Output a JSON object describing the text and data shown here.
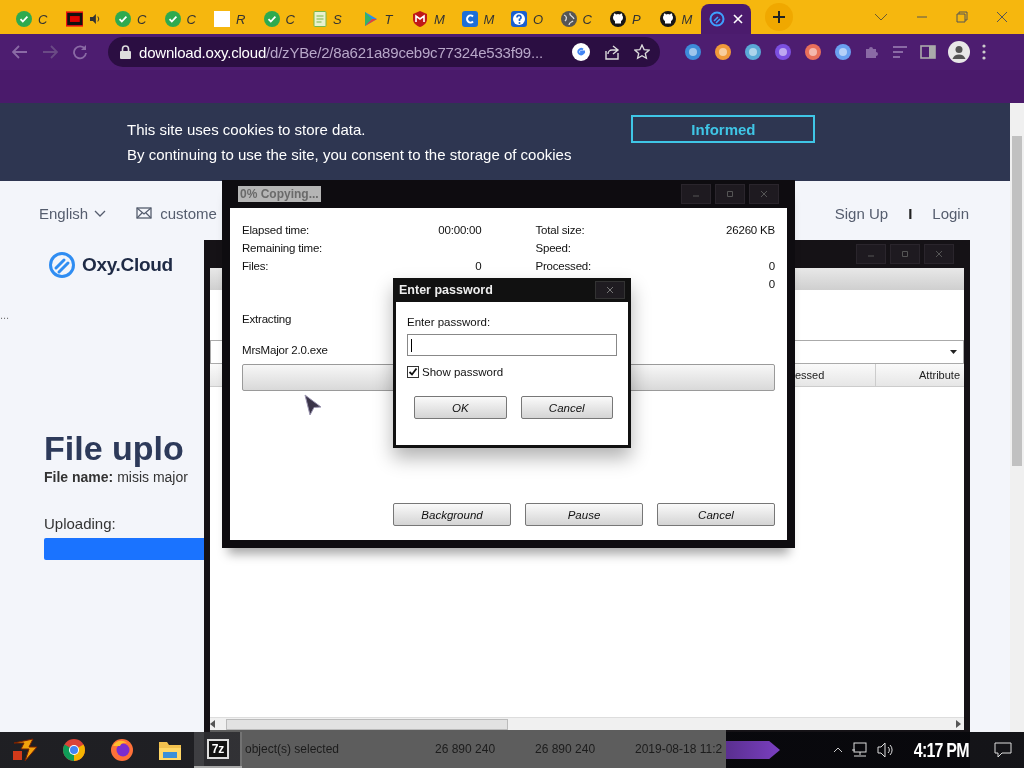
{
  "browser": {
    "tabs": [
      {
        "kind": "check",
        "label": "C",
        "audio": false,
        "selected": false
      },
      {
        "kind": "hd",
        "audio": true,
        "selected": false
      },
      {
        "kind": "check",
        "label": "C",
        "audio": false,
        "selected": false
      },
      {
        "kind": "check",
        "label": "C",
        "audio": false,
        "selected": false
      },
      {
        "kind": "blank",
        "label": "R",
        "audio": false,
        "selected": false
      },
      {
        "kind": "check",
        "label": "C",
        "audio": false,
        "selected": false
      },
      {
        "kind": "sheet",
        "label": "S",
        "audio": false,
        "selected": false
      },
      {
        "kind": "play",
        "label": "T",
        "audio": false,
        "selected": false
      },
      {
        "kind": "shield",
        "label": "M",
        "audio": false,
        "selected": false
      },
      {
        "kind": "square",
        "label": "M",
        "audio": false,
        "selected": false
      },
      {
        "kind": "question",
        "label": "O",
        "audio": false,
        "selected": false
      },
      {
        "kind": "globe",
        "label": "C",
        "audio": false,
        "selected": false
      },
      {
        "kind": "github",
        "label": "P",
        "audio": false,
        "selected": false
      },
      {
        "kind": "github",
        "label": "M",
        "audio": false,
        "selected": false
      },
      {
        "kind": "oxy",
        "audio": false,
        "selected": true
      }
    ],
    "address_bar": {
      "host": "download.oxy.cloud",
      "path": "/d/zYBe/2/8a621a89ceb9c77324e533f99..."
    }
  },
  "cookie_banner": {
    "lines": [
      "This site uses cookies to store data.",
      "By continuing to use the site, you consent to the storage of cookies"
    ],
    "button": "Informed"
  },
  "site": {
    "language": "English",
    "contact": "custome",
    "sign_up": "Sign Up",
    "separator": "I",
    "login": "Login",
    "logo": "Oxy.Cloud",
    "ellipsis": "...",
    "heading": "File uplo",
    "file_name": "**File name:** misis major",
    "upload_label": "Uploading:"
  },
  "archive_window": {
    "columns": [
      "essed",
      "Attribute"
    ],
    "status": [
      "object(s) selected",
      "26 890 240",
      "26 890 240",
      "2019-08-18 11:2"
    ]
  },
  "copy_dialog": {
    "title": "0% Copying...",
    "left_stats": [
      {
        "label": "Elapsed time:",
        "value": "00:00:00"
      },
      {
        "label": "Remaining time:"
      },
      {
        "label": "Files:",
        "value": "0"
      }
    ],
    "right_stats": [
      {
        "label": "Total size:",
        "value": "26260 KB"
      },
      {
        "label": "Speed:"
      },
      {
        "label": "Processed:",
        "value": "0"
      },
      {
        "value": "0"
      }
    ],
    "action": "Extracting",
    "file": "MrsMajor 2.0.exe",
    "level": 0,
    "buttons": [
      "Background",
      "Pause",
      "Cancel"
    ]
  },
  "password_dialog": {
    "title": "Enter password",
    "prompt": "Enter password:",
    "show_password": {
      "label": "Show password",
      "checked": true
    },
    "buttons": [
      "OK",
      "Cancel"
    ]
  },
  "taskbar": {
    "apps": [
      {
        "kind": "chrome",
        "selected": false
      },
      {
        "kind": "firefox",
        "selected": false
      },
      {
        "kind": "folder",
        "selected": false
      },
      {
        "kind": "archiver",
        "label": "7z",
        "selected": true
      }
    ],
    "clock": "4:17 PM"
  }
}
